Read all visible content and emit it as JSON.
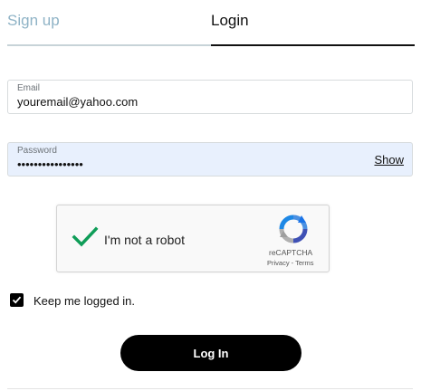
{
  "tabs": {
    "signup_label": "Sign up",
    "login_label": "Login",
    "active": "login"
  },
  "email": {
    "label": "Email",
    "value": "youremail@yahoo.com"
  },
  "password": {
    "label": "Password",
    "masked_value": "••••••••••••••••",
    "show_label": "Show"
  },
  "captcha": {
    "label": "I'm not a robot",
    "brand": "reCAPTCHA",
    "privacy": "Privacy",
    "separator": " - ",
    "terms": "Terms",
    "checked": true
  },
  "keep_logged_in": {
    "label": "Keep me logged in.",
    "checked": true
  },
  "login_button": {
    "label": "Log In"
  },
  "colors": {
    "inactive_tab": "#8fb3c6",
    "password_bg": "#e8f0fd",
    "captcha_check": "#0f9d58",
    "button_bg": "#000000"
  },
  "icons": {
    "captcha_check": "checkmark-icon",
    "captcha_logo": "recaptcha-logo-icon",
    "keep_checkbox": "checkbox-checked-icon"
  }
}
